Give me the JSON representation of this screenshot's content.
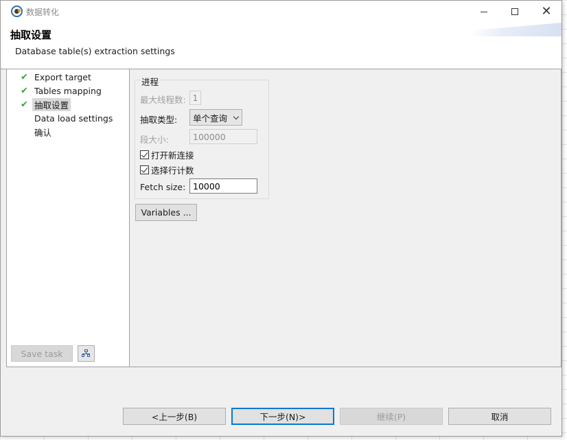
{
  "window": {
    "title": "数据转化",
    "min_icon": "minimize-icon",
    "max_icon": "maximize-icon",
    "close_icon": "close-icon",
    "close_glyph": "✕"
  },
  "header": {
    "title": "抽取设置",
    "subtitle": "Database table(s) extraction settings"
  },
  "steps": [
    {
      "label": "Export target",
      "checked": true,
      "check_glyph": "✔"
    },
    {
      "label": "Tables mapping",
      "checked": true,
      "check_glyph": "✔"
    },
    {
      "label": "抽取设置",
      "checked": true,
      "active": true,
      "check_glyph": "✔"
    },
    {
      "label": "Data load settings",
      "checked": false
    },
    {
      "label": "确认",
      "checked": false
    }
  ],
  "left_buttons": {
    "save_task": "Save task",
    "tree_icon": "hierarchy-icon"
  },
  "progress_group": {
    "title": "进程",
    "max_threads_label": "最大线程数:",
    "max_threads_value": "1",
    "extract_type_label": "抽取类型:",
    "extract_type_value": "单个查询",
    "segment_size_label": "段大小:",
    "segment_size_value": "100000",
    "open_new_connection_label": "打开新连接",
    "open_new_connection_checked": true,
    "select_row_count_label": "选择行计数",
    "select_row_count_checked": true,
    "fetch_size_label": "Fetch size:",
    "fetch_size_value": "10000"
  },
  "variables_button": "Variables ...",
  "footer": {
    "back": "<上一步(B)",
    "next": "下一步(N)>",
    "continue": "继续(P)",
    "cancel": "取消"
  },
  "colors": {
    "check": "#3aa03a",
    "primary_border": "#0078d7",
    "dialog_bg": "#f0f0f0"
  }
}
